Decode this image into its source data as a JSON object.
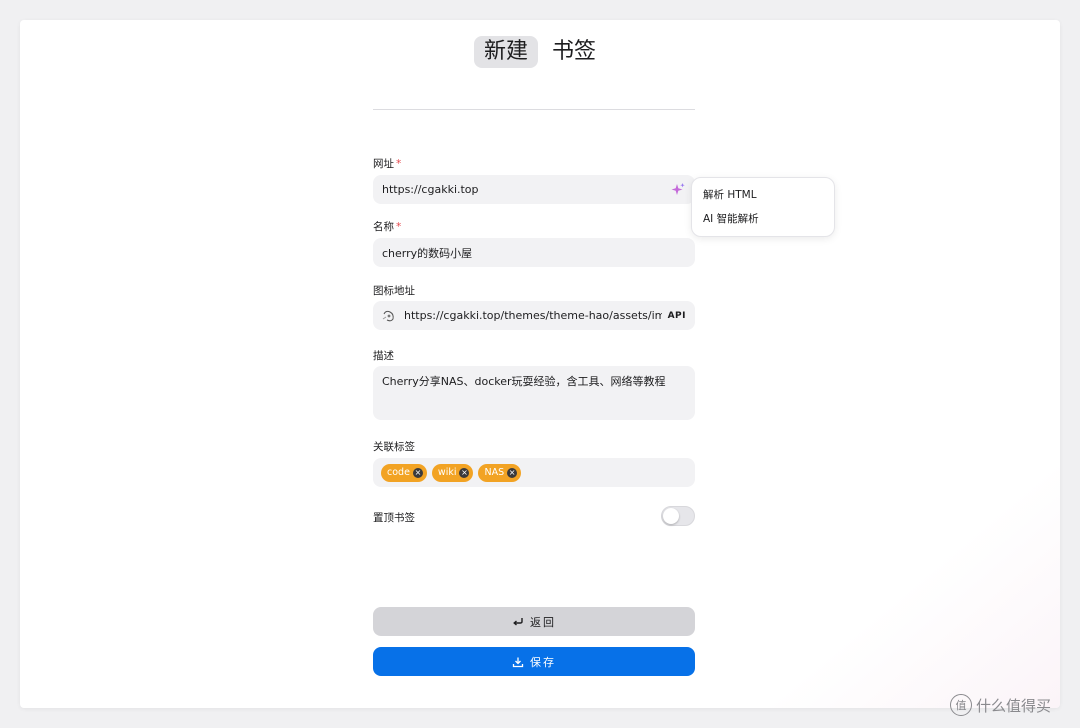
{
  "header": {
    "tabs": [
      {
        "label": "新建",
        "active": true
      },
      {
        "label": "书签",
        "active": false
      }
    ]
  },
  "form": {
    "url": {
      "label": "网址",
      "required_mark": "*",
      "value": "https://cgakki.top",
      "action_icon": "sparkle-icon"
    },
    "name": {
      "label": "名称",
      "required_mark": "*",
      "value": "cherry的数码小屋"
    },
    "icon_url": {
      "label": "图标地址",
      "value": "https://cgakki.top/themes/theme-hao/assets/images/",
      "api_label": "API"
    },
    "description": {
      "label": "描述",
      "value": "Cherry分享NAS、docker玩耍经验，含工具、网络等教程"
    },
    "tags": {
      "label": "关联标签",
      "items": [
        "code",
        "wiki",
        "NAS"
      ],
      "color": "#f2a324"
    },
    "pin": {
      "label": "置顶书签",
      "enabled": false
    }
  },
  "dropdown": {
    "items": [
      "解析 HTML",
      "AI 智能解析"
    ]
  },
  "buttons": {
    "back": "返回",
    "save": "保存",
    "save_color": "#0771e8"
  },
  "watermark": {
    "text": "什么值得买",
    "icon_glyph": "值"
  }
}
